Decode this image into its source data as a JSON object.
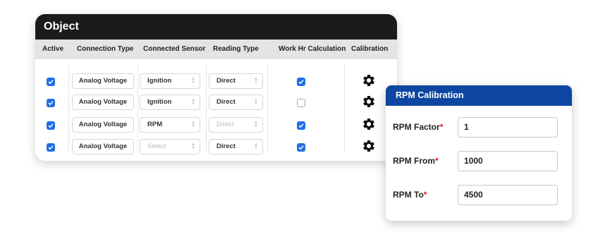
{
  "panel": {
    "title": "Object",
    "columns": [
      "Active",
      "Connection Type",
      "Connected Sensor",
      "Reading Type",
      "Work Hr Calculation",
      "Calibration"
    ],
    "rows": [
      {
        "active": true,
        "connection_type": "Analog Voltage",
        "sensor": "Ignition",
        "sensor_placeholder": false,
        "reading_type": "Direct",
        "reading_disabled": false,
        "work_hr": true
      },
      {
        "active": true,
        "connection_type": "Analog Voltage",
        "sensor": "Ignition",
        "sensor_placeholder": false,
        "reading_type": "Direct",
        "reading_disabled": false,
        "work_hr": false
      },
      {
        "active": true,
        "connection_type": "Analog Voltage",
        "sensor": "RPM",
        "sensor_placeholder": false,
        "reading_type": "Direct",
        "reading_disabled": true,
        "work_hr": true
      },
      {
        "active": true,
        "connection_type": "Analog Voltage",
        "sensor": "Select",
        "sensor_placeholder": true,
        "reading_type": "Direct",
        "reading_disabled": false,
        "work_hr": true
      }
    ],
    "calibration_icon": "gear-icon"
  },
  "modal": {
    "title": "RPM Calibration",
    "fields": [
      {
        "label": "RPM Factor",
        "required_mark": "*",
        "value": "1"
      },
      {
        "label": "RPM From",
        "required_mark": "*",
        "value": "1000"
      },
      {
        "label": "RPM To",
        "required_mark": "*",
        "value": "4500"
      }
    ]
  },
  "colors": {
    "header_dark": "#1b1b1b",
    "checkbox_blue": "#1f6fe5",
    "modal_header_blue": "#0d47a1",
    "required_red": "#e02020"
  }
}
